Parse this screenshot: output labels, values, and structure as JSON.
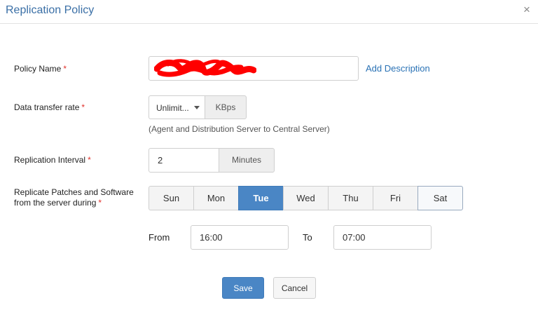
{
  "dialog": {
    "title": "Replication Policy",
    "close_icon": "×"
  },
  "policy_name": {
    "label": "Policy Name",
    "required": "*",
    "value": "",
    "add_description": "Add Description"
  },
  "transfer_rate": {
    "label": "Data transfer rate",
    "required": "*",
    "selected": "Unlimit...",
    "unit": "KBps",
    "helper": "(Agent and Distribution Server to Central Server)"
  },
  "interval": {
    "label": "Replication Interval",
    "required": "*",
    "value": "2",
    "unit": "Minutes"
  },
  "schedule": {
    "label_line1": "Replicate Patches and Software",
    "label_line2": "from the server during",
    "required": "*",
    "days": [
      "Sun",
      "Mon",
      "Tue",
      "Wed",
      "Thu",
      "Fri",
      "Sat"
    ],
    "selected_day": "Tue",
    "from_label": "From",
    "from_value": "16:00",
    "to_label": "To",
    "to_value": "07:00"
  },
  "buttons": {
    "save": "Save",
    "cancel": "Cancel"
  },
  "colors": {
    "accent": "#4a86c5",
    "title": "#3a6fa6",
    "link": "#2a72b5",
    "required": "#e0312b",
    "redaction": "#ff0000"
  }
}
